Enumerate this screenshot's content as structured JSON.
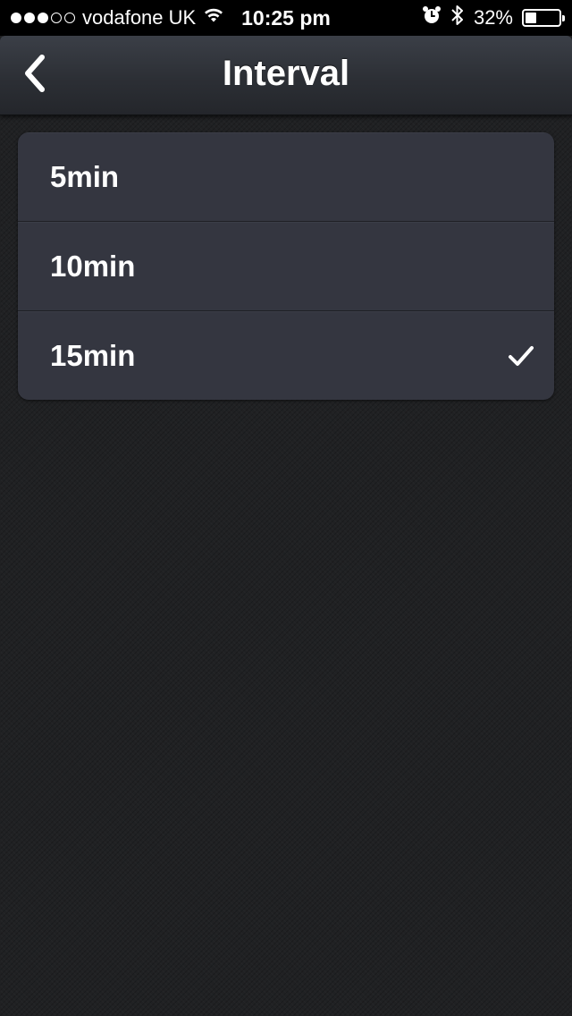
{
  "status_bar": {
    "signal_dots": [
      true,
      true,
      true,
      false,
      false
    ],
    "carrier": "vodafone UK",
    "time": "10:25 pm",
    "battery_percent_label": "32%",
    "battery_level": 0.32,
    "icons": [
      "wifi-icon",
      "alarm-icon",
      "bluetooth-icon",
      "battery-icon"
    ]
  },
  "nav": {
    "title": "Interval",
    "back_icon": "chevron-left-icon"
  },
  "options": {
    "items": [
      {
        "label": "5min",
        "selected": false
      },
      {
        "label": "10min",
        "selected": false
      },
      {
        "label": "15min",
        "selected": true
      }
    ],
    "selected_icon": "checkmark-icon"
  },
  "colors": {
    "nav_bar": "#2f3238",
    "card_background": "#343640",
    "page_background": "#202123",
    "text": "#ffffff"
  }
}
